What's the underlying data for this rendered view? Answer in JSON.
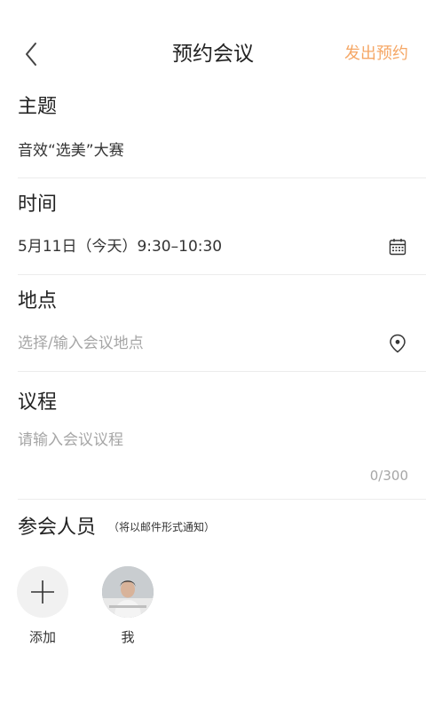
{
  "header": {
    "title": "预约会议",
    "submit_label": "发出预约"
  },
  "topic": {
    "label": "主题",
    "value": "音效“选美”大赛"
  },
  "time": {
    "label": "时间",
    "value": "5月11日（今天）9:30–10:30"
  },
  "location": {
    "label": "地点",
    "placeholder": "选择/输入会议地点"
  },
  "agenda": {
    "label": "议程",
    "placeholder": "请输入会议议程",
    "counter": "0/300"
  },
  "attendees": {
    "label": "参会人员",
    "note": "（将以邮件形式通知）",
    "add_label": "添加",
    "me_label": "我"
  },
  "colors": {
    "accent": "#f5a766",
    "placeholder": "#a6a6a6",
    "divider": "#ececec"
  },
  "icons": {
    "back": "chevron-left-icon",
    "calendar": "calendar-icon",
    "location": "location-pin-icon",
    "add": "plus-icon"
  }
}
